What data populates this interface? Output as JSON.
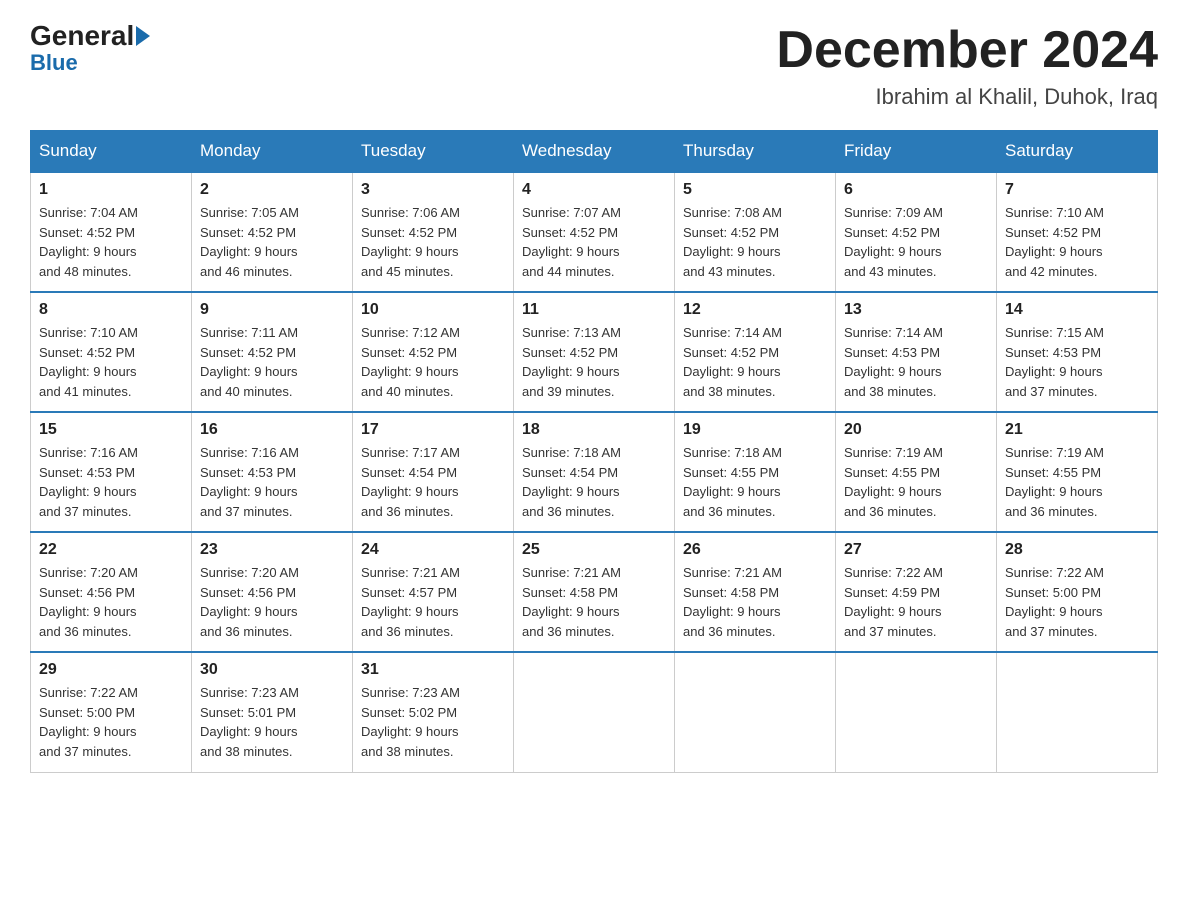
{
  "logo": {
    "general": "General",
    "blue": "Blue"
  },
  "header": {
    "month_year": "December 2024",
    "location": "Ibrahim al Khalil, Duhok, Iraq"
  },
  "weekdays": [
    "Sunday",
    "Monday",
    "Tuesday",
    "Wednesday",
    "Thursday",
    "Friday",
    "Saturday"
  ],
  "weeks": [
    [
      {
        "day": "1",
        "sunrise": "7:04 AM",
        "sunset": "4:52 PM",
        "daylight": "9 hours and 48 minutes."
      },
      {
        "day": "2",
        "sunrise": "7:05 AM",
        "sunset": "4:52 PM",
        "daylight": "9 hours and 46 minutes."
      },
      {
        "day": "3",
        "sunrise": "7:06 AM",
        "sunset": "4:52 PM",
        "daylight": "9 hours and 45 minutes."
      },
      {
        "day": "4",
        "sunrise": "7:07 AM",
        "sunset": "4:52 PM",
        "daylight": "9 hours and 44 minutes."
      },
      {
        "day": "5",
        "sunrise": "7:08 AM",
        "sunset": "4:52 PM",
        "daylight": "9 hours and 43 minutes."
      },
      {
        "day": "6",
        "sunrise": "7:09 AM",
        "sunset": "4:52 PM",
        "daylight": "9 hours and 43 minutes."
      },
      {
        "day": "7",
        "sunrise": "7:10 AM",
        "sunset": "4:52 PM",
        "daylight": "9 hours and 42 minutes."
      }
    ],
    [
      {
        "day": "8",
        "sunrise": "7:10 AM",
        "sunset": "4:52 PM",
        "daylight": "9 hours and 41 minutes."
      },
      {
        "day": "9",
        "sunrise": "7:11 AM",
        "sunset": "4:52 PM",
        "daylight": "9 hours and 40 minutes."
      },
      {
        "day": "10",
        "sunrise": "7:12 AM",
        "sunset": "4:52 PM",
        "daylight": "9 hours and 40 minutes."
      },
      {
        "day": "11",
        "sunrise": "7:13 AM",
        "sunset": "4:52 PM",
        "daylight": "9 hours and 39 minutes."
      },
      {
        "day": "12",
        "sunrise": "7:14 AM",
        "sunset": "4:52 PM",
        "daylight": "9 hours and 38 minutes."
      },
      {
        "day": "13",
        "sunrise": "7:14 AM",
        "sunset": "4:53 PM",
        "daylight": "9 hours and 38 minutes."
      },
      {
        "day": "14",
        "sunrise": "7:15 AM",
        "sunset": "4:53 PM",
        "daylight": "9 hours and 37 minutes."
      }
    ],
    [
      {
        "day": "15",
        "sunrise": "7:16 AM",
        "sunset": "4:53 PM",
        "daylight": "9 hours and 37 minutes."
      },
      {
        "day": "16",
        "sunrise": "7:16 AM",
        "sunset": "4:53 PM",
        "daylight": "9 hours and 37 minutes."
      },
      {
        "day": "17",
        "sunrise": "7:17 AM",
        "sunset": "4:54 PM",
        "daylight": "9 hours and 36 minutes."
      },
      {
        "day": "18",
        "sunrise": "7:18 AM",
        "sunset": "4:54 PM",
        "daylight": "9 hours and 36 minutes."
      },
      {
        "day": "19",
        "sunrise": "7:18 AM",
        "sunset": "4:55 PM",
        "daylight": "9 hours and 36 minutes."
      },
      {
        "day": "20",
        "sunrise": "7:19 AM",
        "sunset": "4:55 PM",
        "daylight": "9 hours and 36 minutes."
      },
      {
        "day": "21",
        "sunrise": "7:19 AM",
        "sunset": "4:55 PM",
        "daylight": "9 hours and 36 minutes."
      }
    ],
    [
      {
        "day": "22",
        "sunrise": "7:20 AM",
        "sunset": "4:56 PM",
        "daylight": "9 hours and 36 minutes."
      },
      {
        "day": "23",
        "sunrise": "7:20 AM",
        "sunset": "4:56 PM",
        "daylight": "9 hours and 36 minutes."
      },
      {
        "day": "24",
        "sunrise": "7:21 AM",
        "sunset": "4:57 PM",
        "daylight": "9 hours and 36 minutes."
      },
      {
        "day": "25",
        "sunrise": "7:21 AM",
        "sunset": "4:58 PM",
        "daylight": "9 hours and 36 minutes."
      },
      {
        "day": "26",
        "sunrise": "7:21 AM",
        "sunset": "4:58 PM",
        "daylight": "9 hours and 36 minutes."
      },
      {
        "day": "27",
        "sunrise": "7:22 AM",
        "sunset": "4:59 PM",
        "daylight": "9 hours and 37 minutes."
      },
      {
        "day": "28",
        "sunrise": "7:22 AM",
        "sunset": "5:00 PM",
        "daylight": "9 hours and 37 minutes."
      }
    ],
    [
      {
        "day": "29",
        "sunrise": "7:22 AM",
        "sunset": "5:00 PM",
        "daylight": "9 hours and 37 minutes."
      },
      {
        "day": "30",
        "sunrise": "7:23 AM",
        "sunset": "5:01 PM",
        "daylight": "9 hours and 38 minutes."
      },
      {
        "day": "31",
        "sunrise": "7:23 AM",
        "sunset": "5:02 PM",
        "daylight": "9 hours and 38 minutes."
      },
      null,
      null,
      null,
      null
    ]
  ],
  "labels": {
    "sunrise": "Sunrise: ",
    "sunset": "Sunset: ",
    "daylight": "Daylight: "
  }
}
